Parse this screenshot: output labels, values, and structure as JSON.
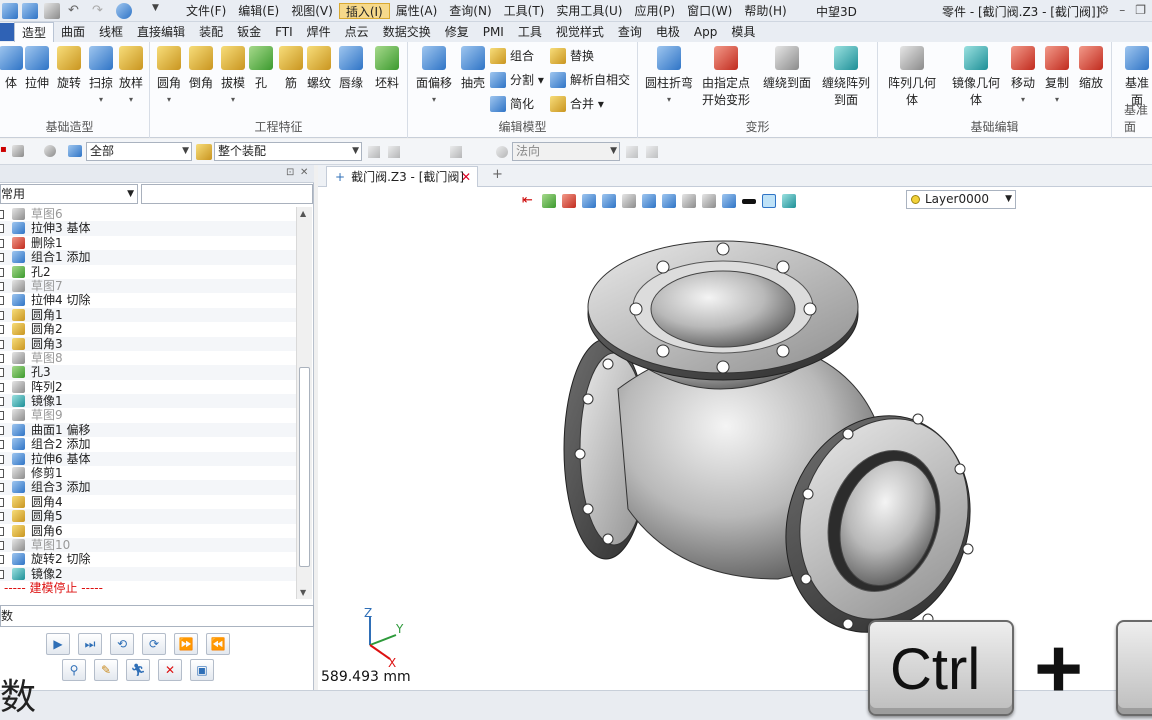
{
  "menu": {
    "items": [
      "文件(F)",
      "编辑(E)",
      "视图(V)",
      "插入(I)",
      "属性(A)",
      "查询(N)",
      "工具(T)",
      "实用工具(U)",
      "应用(P)",
      "窗口(W)",
      "帮助(H)"
    ],
    "active_index": 3,
    "app_title": "中望3D",
    "doc_title": "零件 - [截门阀.Z3 - [截门阀]]"
  },
  "ribbon_tabs": [
    "造型",
    "曲面",
    "线框",
    "直接编辑",
    "装配",
    "钣金",
    "FTI",
    "焊件",
    "点云",
    "数据交换",
    "修复",
    "PMI",
    "工具",
    "视觉样式",
    "查询",
    "电极",
    "App",
    "模具"
  ],
  "ribbon": {
    "groups": [
      {
        "name": "基础造型",
        "buttons": [
          "体",
          "拉伸",
          "旋转",
          "扫掠",
          "放样"
        ]
      },
      {
        "name": "工程特征",
        "buttons": [
          "圆角",
          "倒角",
          "拔模",
          "孔",
          "筋",
          "螺纹",
          "唇缘",
          "坯料"
        ]
      },
      {
        "name": "编辑模型",
        "buttons": [
          "面偏移",
          "抽壳"
        ],
        "small": [
          "组合",
          "替换",
          "分割",
          "解析自相交",
          "简化",
          "合并"
        ]
      },
      {
        "name": "变形",
        "buttons": [
          "圆柱折弯",
          "由指定点\n开始变形",
          "缠绕到面",
          "缠绕阵列\n到面"
        ]
      },
      {
        "name": "基础编辑",
        "buttons": [
          "阵列几何\n体",
          "镜像几何\n体",
          "移动",
          "复制",
          "缩放"
        ]
      },
      {
        "name": "基准面",
        "buttons": [
          "基准面"
        ]
      }
    ]
  },
  "filterbar": {
    "filter_value": "全部",
    "assembly_value": "整个装配",
    "direction_value": "法向"
  },
  "left_panel": {
    "filter_value": "常用",
    "tree": [
      {
        "label": "草图6",
        "muted": true,
        "icon": "gray"
      },
      {
        "label": "拉伸3  基体",
        "icon": "blue"
      },
      {
        "label": "删除1",
        "icon": "red"
      },
      {
        "label": "组合1  添加",
        "icon": "blue"
      },
      {
        "label": "孔2",
        "icon": "green"
      },
      {
        "label": "草图7",
        "muted": true,
        "icon": "gray"
      },
      {
        "label": "拉伸4  切除",
        "icon": "blue"
      },
      {
        "label": "圆角1",
        "icon": "gold"
      },
      {
        "label": "圆角2",
        "icon": "gold"
      },
      {
        "label": "圆角3",
        "icon": "gold"
      },
      {
        "label": "草图8",
        "muted": true,
        "icon": "gray"
      },
      {
        "label": "孔3",
        "icon": "green"
      },
      {
        "label": "阵列2",
        "icon": "gray"
      },
      {
        "label": "镜像1",
        "icon": "teal"
      },
      {
        "label": "草图9",
        "muted": true,
        "icon": "gray"
      },
      {
        "label": "曲面1  偏移",
        "icon": "blue"
      },
      {
        "label": "组合2  添加",
        "icon": "blue"
      },
      {
        "label": "拉伸6  基体",
        "icon": "blue"
      },
      {
        "label": "修剪1",
        "icon": "gray"
      },
      {
        "label": "组合3  添加",
        "icon": "blue"
      },
      {
        "label": "圆角4",
        "icon": "gold"
      },
      {
        "label": "圆角5",
        "icon": "gold"
      },
      {
        "label": "圆角6",
        "icon": "gold"
      },
      {
        "label": "草图10",
        "muted": true,
        "icon": "gray"
      },
      {
        "label": "旋转2  切除",
        "icon": "blue"
      },
      {
        "label": "镜像2",
        "icon": "teal"
      },
      {
        "label": "----- 建模停止 -----",
        "stop": true
      }
    ],
    "input_label": "数"
  },
  "document_tab": {
    "label": "截门阀.Z3 - [截门阀]"
  },
  "viewport": {
    "layer": "Layer0000",
    "measurement": "589.493 mm",
    "axes": {
      "x": "X",
      "y": "Y",
      "z": "Z"
    }
  },
  "overlay_keys": {
    "ctrl": "Ctrl",
    "plus": "+"
  },
  "bottom_left_text": "数"
}
